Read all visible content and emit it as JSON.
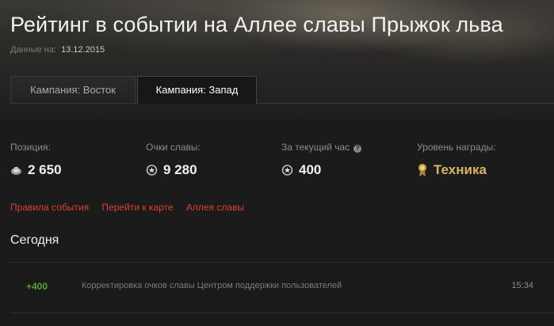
{
  "header": {
    "title": "Рейтинг в событии на Аллее славы Прыжок льва",
    "date_label": "Данные на:",
    "date_value": "13.12.2015"
  },
  "tabs": [
    {
      "label": "Кампания: Восток",
      "active": false
    },
    {
      "label": "Кампания: Запад",
      "active": true
    }
  ],
  "stats": {
    "position": {
      "label": "Позиция:",
      "value": "2 650",
      "icon": "position-icon"
    },
    "glory_points": {
      "label": "Очки славы:",
      "value": "9 280",
      "icon": "glory-points-icon"
    },
    "current_hour": {
      "label": "За текущий час",
      "value": "400",
      "icon": "glory-points-icon",
      "help_icon": "?"
    },
    "reward_level": {
      "label": "Уровень награды:",
      "value": "Техника",
      "icon": "medal-icon"
    }
  },
  "links": [
    {
      "label": "Правила события"
    },
    {
      "label": "Перейти к карте"
    },
    {
      "label": "Аллея славы"
    }
  ],
  "today": {
    "title": "Сегодня",
    "entries": [
      {
        "points": "+400",
        "description": "Корректировка очков славы Центром поддержки пользователей",
        "time": "15:34"
      }
    ]
  },
  "colors": {
    "link": "#d9412e",
    "gold": "#d7b463",
    "positive": "#5aa331",
    "background": "#1b1b1c"
  }
}
